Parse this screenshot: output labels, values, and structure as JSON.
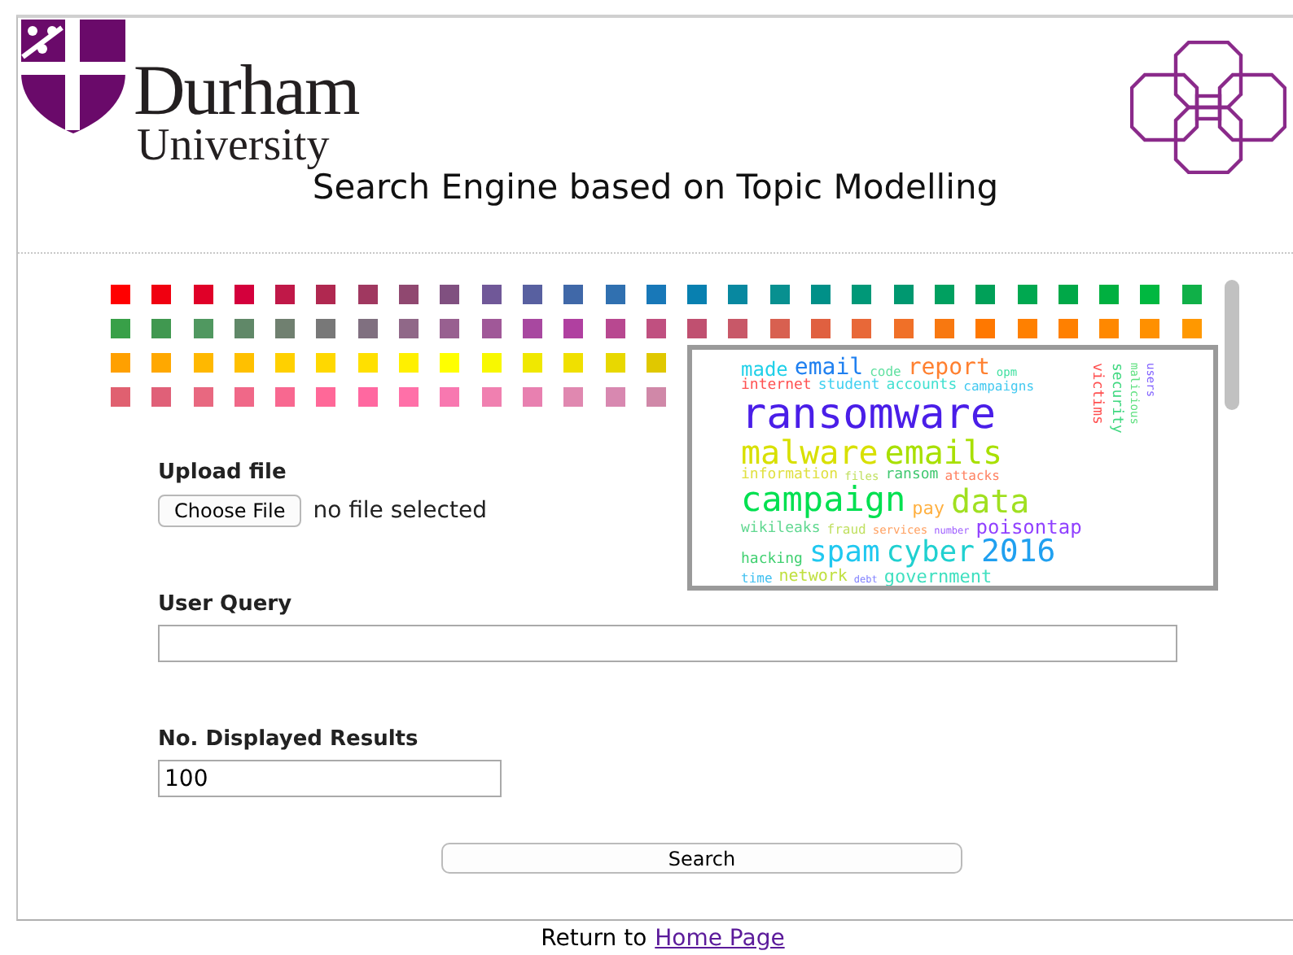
{
  "header": {
    "logo_name": "Durham",
    "logo_subtitle": "University",
    "title": "Search Engine based on Topic Modelling"
  },
  "swatch_rows": [
    [
      {
        "color": "#ff0000"
      },
      {
        "color": "#f00010"
      },
      {
        "color": "#e00028"
      },
      {
        "color": "#d4003c"
      },
      {
        "color": "#c01848"
      },
      {
        "color": "#b02850"
      },
      {
        "color": "#a03860"
      },
      {
        "color": "#904870"
      },
      {
        "color": "#805080"
      },
      {
        "color": "#705898"
      },
      {
        "color": "#5860a0"
      },
      {
        "color": "#4068a8"
      },
      {
        "color": "#3070b0"
      },
      {
        "color": "#1878b8"
      },
      {
        "color": "#0880b0"
      },
      {
        "color": "#0888a0"
      },
      {
        "color": "#089090"
      },
      {
        "color": "#009088"
      },
      {
        "color": "#009878"
      },
      {
        "color": "#009870"
      },
      {
        "color": "#00a060"
      },
      {
        "color": "#00a058"
      },
      {
        "color": "#00a850"
      },
      {
        "color": "#00a848"
      },
      {
        "color": "#00b040"
      },
      {
        "color": "#00b840"
      },
      {
        "color": "#10b048"
      }
    ],
    [
      {
        "color": "#38a048"
      },
      {
        "color": "#409850"
      },
      {
        "color": "#509860"
      },
      {
        "color": "#608868"
      },
      {
        "color": "#708070"
      },
      {
        "color": "#787878"
      },
      {
        "color": "#807080"
      },
      {
        "color": "#906888"
      },
      {
        "color": "#986090"
      },
      {
        "color": "#a05898"
      },
      {
        "color": "#a848a0"
      },
      {
        "color": "#b040a0"
      },
      {
        "color": "#b84890"
      },
      {
        "color": "#c05080"
      },
      {
        "color": "#c05070"
      },
      {
        "color": "#c85868"
      },
      {
        "color": "#d86050"
      },
      {
        "color": "#e06040"
      },
      {
        "color": "#e86838"
      },
      {
        "color": "#f07028"
      },
      {
        "color": "#f87810"
      },
      {
        "color": "#ff7800"
      },
      {
        "color": "#ff8000"
      },
      {
        "color": "#ff8000"
      },
      {
        "color": "#ff8800"
      },
      {
        "color": "#ff9000"
      },
      {
        "color": "#ff9800"
      }
    ],
    [
      {
        "color": "#ffa000"
      },
      {
        "color": "#ffa800"
      },
      {
        "color": "#ffb800"
      },
      {
        "color": "#ffc000"
      },
      {
        "color": "#ffd000"
      },
      {
        "color": "#ffd800"
      },
      {
        "color": "#ffe000"
      },
      {
        "color": "#fff000"
      },
      {
        "color": "#ffff00"
      },
      {
        "color": "#f8f800"
      },
      {
        "color": "#f0e800"
      },
      {
        "color": "#f0e000"
      },
      {
        "color": "#e8d800"
      },
      {
        "color": "#e0c800"
      }
    ],
    [
      {
        "color": "#e06070"
      },
      {
        "color": "#e06078"
      },
      {
        "color": "#e86880"
      },
      {
        "color": "#f06888"
      },
      {
        "color": "#f86890"
      },
      {
        "color": "#ff6898"
      },
      {
        "color": "#ff68a0"
      },
      {
        "color": "#ff70a8"
      },
      {
        "color": "#f878b0"
      },
      {
        "color": "#f080b0"
      },
      {
        "color": "#e880b0"
      },
      {
        "color": "#e088b0"
      },
      {
        "color": "#d888b0"
      },
      {
        "color": "#d088a8"
      }
    ]
  ],
  "word_cloud": {
    "rows": [
      [
        {
          "text": "made",
          "color": "#20d0e8"
        },
        {
          "text": "email",
          "color": "#2080f0"
        },
        {
          "text": "code",
          "color": "#60e0a0"
        },
        {
          "text": "report",
          "color": "#ff8030"
        },
        {
          "text": "opm",
          "color": "#40e0a0"
        }
      ],
      [
        {
          "text": "internet",
          "color": "#ff5050"
        },
        {
          "text": "student",
          "color": "#40d0f0"
        },
        {
          "text": "accounts",
          "color": "#40e0d0"
        },
        {
          "text": "campaigns",
          "color": "#40c8f0"
        }
      ],
      [
        {
          "text": "ransomware",
          "color": "#4a1ee8"
        }
      ],
      [
        {
          "text": "malware",
          "color": "#d8e000"
        },
        {
          "text": "emails",
          "color": "#a8e000"
        }
      ],
      [
        {
          "text": "information",
          "color": "#e0e040"
        },
        {
          "text": "files",
          "color": "#c0e060"
        },
        {
          "text": "ransom",
          "color": "#40c870"
        },
        {
          "text": "attacks",
          "color": "#ff8060"
        }
      ],
      [
        {
          "text": "campaign",
          "color": "#00e050"
        },
        {
          "text": "pay",
          "color": "#ffb040"
        },
        {
          "text": "data",
          "color": "#a0e020"
        }
      ],
      [
        {
          "text": "wikileaks",
          "color": "#60d890"
        },
        {
          "text": "fraud",
          "color": "#c0e060"
        },
        {
          "text": "services",
          "color": "#ffa060"
        },
        {
          "text": "number",
          "color": "#a060ff"
        },
        {
          "text": "poisontap",
          "color": "#9040ff"
        }
      ],
      [
        {
          "text": "hacking",
          "color": "#40d070"
        },
        {
          "text": "spam",
          "color": "#20c8f0"
        },
        {
          "text": "cyber",
          "color": "#20d0d0"
        },
        {
          "text": "2016",
          "color": "#20a0f0"
        }
      ],
      [
        {
          "text": "time",
          "color": "#40c0f0"
        },
        {
          "text": "network",
          "color": "#c0e040"
        },
        {
          "text": "debt",
          "color": "#8080ff"
        },
        {
          "text": "government",
          "color": "#40e0c0"
        }
      ]
    ],
    "side_words": [
      {
        "text": "victims",
        "color": "#ff5050"
      },
      {
        "text": "security",
        "color": "#40d880"
      },
      {
        "text": "malicious",
        "color": "#60e080"
      },
      {
        "text": "users",
        "color": "#8060ff"
      }
    ]
  },
  "form": {
    "upload": {
      "label": "Upload file",
      "button": "Choose File",
      "status": "no file selected"
    },
    "query": {
      "label": "User Query"
    },
    "results": {
      "label": "No. Displayed Results",
      "value": "100"
    },
    "search_button": "Search"
  },
  "footer": {
    "text": "Return to",
    "link": "Home Page"
  }
}
